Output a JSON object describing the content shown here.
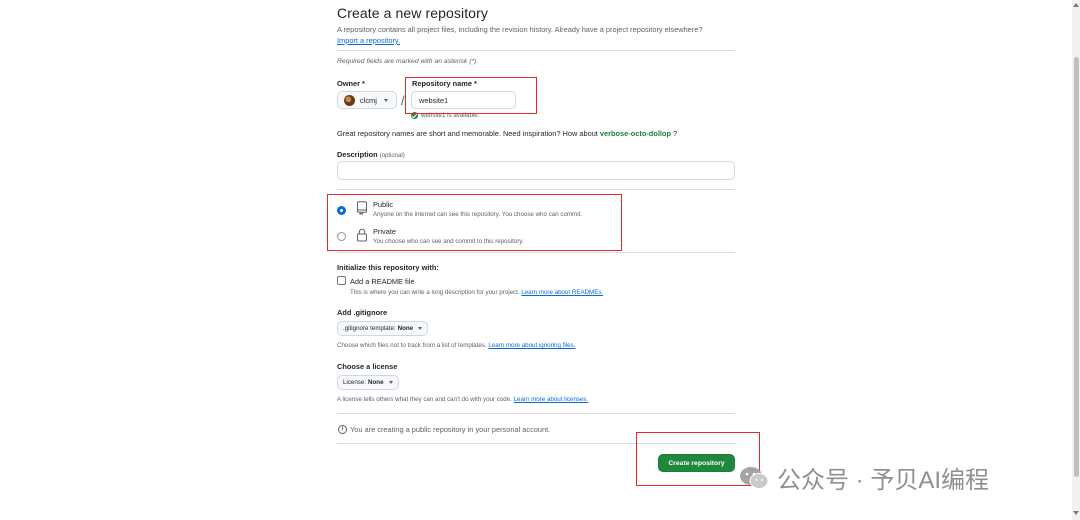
{
  "header": {
    "title": "Create a new repository",
    "intro": "A repository contains all project files, including the revision history. Already have a project repository elsewhere?",
    "import_link": "Import a repository.",
    "required_note": "Required fields are marked with an asterisk (*)."
  },
  "owner": {
    "label": "Owner *",
    "value": "clcmj"
  },
  "repo_name": {
    "label": "Repository name *",
    "value": "website1",
    "availability": "website1 is available."
  },
  "name_hint": {
    "text": "Great repository names are short and memorable. Need inspiration? How about",
    "suggestion": "verbose-octo-dollop",
    "suffix": "?"
  },
  "description": {
    "label": "Description",
    "optional": "(optional)",
    "value": ""
  },
  "visibility": {
    "selected": "Public",
    "options": [
      {
        "title": "Public",
        "desc": "Anyone on the internet can see this repository. You choose who can commit."
      },
      {
        "title": "Private",
        "desc": "You choose who can see and commit to this repository."
      }
    ]
  },
  "initialize": {
    "heading": "Initialize this repository with:",
    "readme_label": "Add a README file",
    "readme_checked": false,
    "readme_desc": "This is where you can write a long description for your project.",
    "readme_link": "Learn more about READMEs."
  },
  "gitignore": {
    "heading": "Add .gitignore",
    "select_prefix": ".gitignore template:",
    "select_value": "None",
    "desc": "Choose which files not to track from a list of templates.",
    "link": "Learn more about ignoring files."
  },
  "license": {
    "heading": "Choose a license",
    "select_prefix": "License:",
    "select_value": "None",
    "desc": "A license tells others what they can and can't do with your code.",
    "link": "Learn more about licenses."
  },
  "info": {
    "icon": "info-icon",
    "text": "You are creating a public repository in your personal account."
  },
  "submit": {
    "label": "Create repository"
  },
  "watermark": {
    "text": "公众号 · 予贝AI编程"
  },
  "colors": {
    "primary_green": "#1f883d",
    "link_blue": "#0969da",
    "annotation_red": "#e8282b",
    "suggestion_green": "#1a7f37"
  }
}
